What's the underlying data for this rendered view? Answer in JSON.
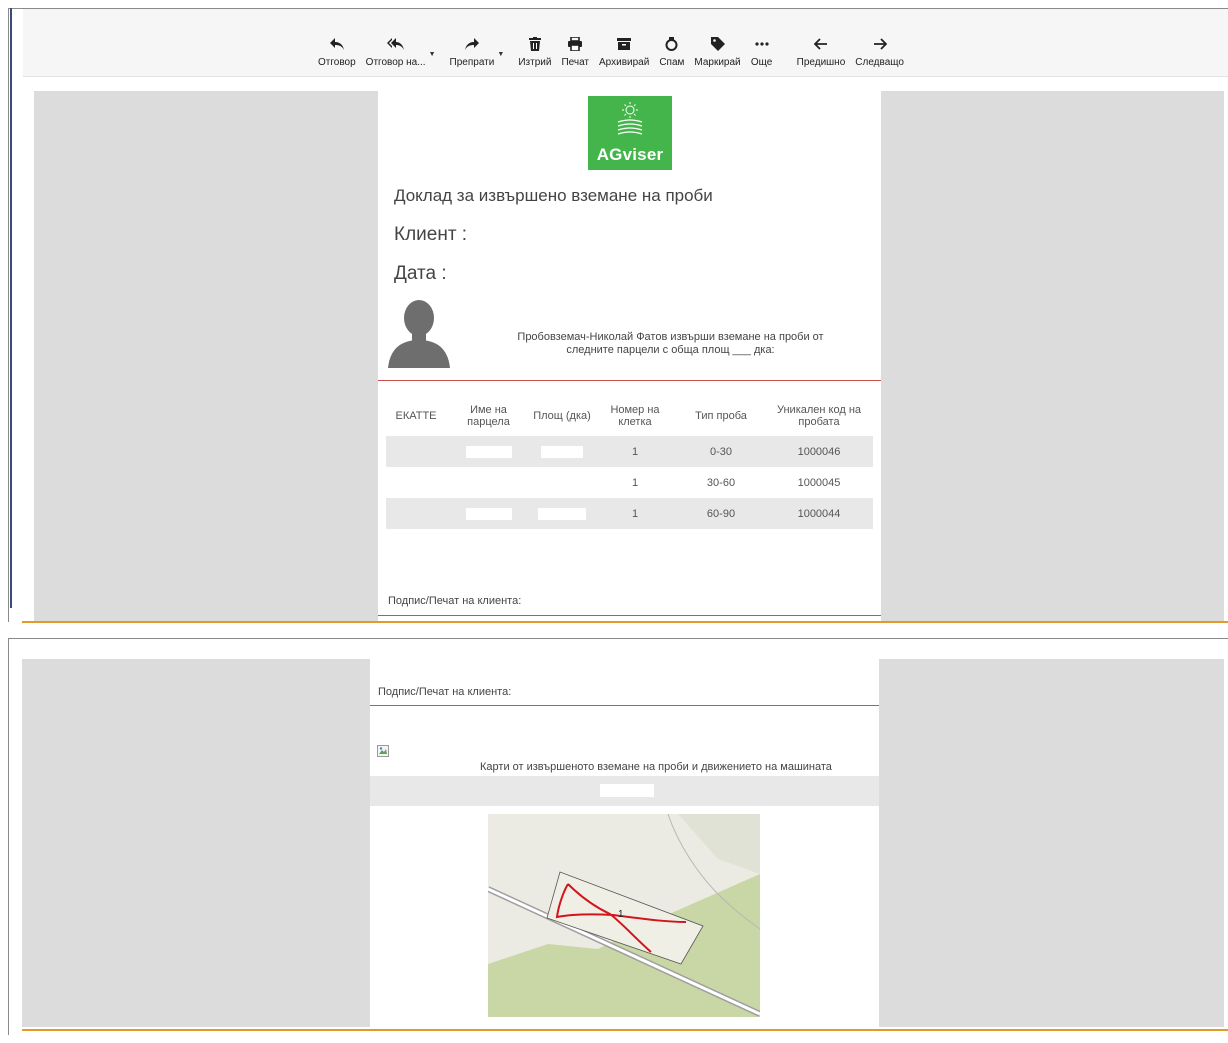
{
  "toolbar": {
    "buttons": [
      {
        "label": "Отговор",
        "icon": "reply-icon"
      },
      {
        "label": "Отговор на...",
        "icon": "reply-all-icon"
      },
      {
        "label": "Препрати",
        "icon": "forward-icon"
      },
      {
        "label": "Изтрий",
        "icon": "trash-icon"
      },
      {
        "label": "Печат",
        "icon": "print-icon"
      },
      {
        "label": "Архивирай",
        "icon": "archive-icon"
      },
      {
        "label": "Спам",
        "icon": "spam-icon"
      },
      {
        "label": "Маркирай",
        "icon": "tag-icon"
      },
      {
        "label": "Още",
        "icon": "more-icon"
      },
      {
        "label": "Предишно",
        "icon": "arrow-left-icon"
      },
      {
        "label": "Следващо",
        "icon": "arrow-right-icon"
      }
    ]
  },
  "report": {
    "logo_text": "AGviser",
    "title": "Доклад за извършено вземане на проби",
    "client_label": "Клиент :",
    "date_label": "Дата :",
    "intro_line1": "Пробовземач-Николай Фатов извърши вземане на проби от",
    "intro_line2": "следните парцели с обща площ ___ дка:",
    "signature_label": "Подпис/Печат на клиента:"
  },
  "table": {
    "headers": [
      "ЕКАТТЕ",
      "Име на парцела",
      "Площ (дка)",
      "Номер на клетка",
      "Тип проба",
      "Уникален код на пробата"
    ],
    "rows": [
      {
        "ekatte": "",
        "name": "",
        "area": "",
        "cell": "1",
        "type": "0-30",
        "code": "1000046"
      },
      {
        "ekatte": "",
        "name": "",
        "area": "",
        "cell": "1",
        "type": "30-60",
        "code": "1000045"
      },
      {
        "ekatte": "",
        "name": "",
        "area": "",
        "cell": "1",
        "type": "60-90",
        "code": "1000044"
      }
    ]
  },
  "page2": {
    "signature_label": "Подпис/Печат на клиента:",
    "maps_title": "Карти от извършеното вземане на проби и движението на машината",
    "map_cell_label": "1"
  },
  "colors": {
    "accent_green": "#44b54a",
    "divider_red": "#c9524d",
    "orange": "#e29b2b",
    "track_red": "#d4141c"
  }
}
